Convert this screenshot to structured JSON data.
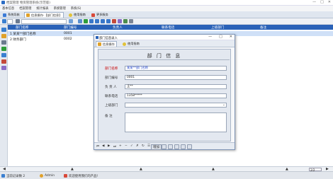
{
  "window": {
    "title": "档案管理 物资管理系统(示范版)",
    "controls": [
      "—",
      "□",
      "✕"
    ]
  },
  "menu": [
    "基本信息",
    "档案管理",
    "统计报表",
    "系统管理",
    "系统(S)"
  ],
  "module_tabs": [
    {
      "label": "系统导航",
      "icon": "home-icon"
    },
    {
      "label": "信息操作-【部门信息】",
      "icon": "form-icon",
      "active": true
    },
    {
      "label": "使用指南",
      "icon": "help-icon"
    },
    {
      "label": "更多服务",
      "icon": "more-icon"
    }
  ],
  "tree": {
    "columns": [
      "部门名称",
      "部门编号",
      "负责人",
      "联系电话",
      "上级部门",
      "备注"
    ],
    "rows": [
      {
        "name": "1  某某**部门名称",
        "code": "0001"
      },
      {
        "name": "2  财务部门",
        "code": "0002"
      }
    ]
  },
  "modal": {
    "title": "部门信息录入",
    "controls": [
      "—",
      "□",
      "✕"
    ],
    "tabs": [
      {
        "label": "信息操作",
        "icon": "form-icon"
      },
      {
        "label": "使用指南",
        "icon": "help-icon"
      }
    ],
    "heading": "部 门 信 息",
    "fields": [
      {
        "label": "部门名称",
        "value": "某某**部门名称",
        "required": true
      },
      {
        "label": "部门编号",
        "value": "0001",
        "required": false
      },
      {
        "label": "负 责 人",
        "value": "王**",
        "required": false
      },
      {
        "label": "联系电话",
        "value": "1358*****",
        "required": false
      },
      {
        "label": "上级部门",
        "value": "",
        "required": false
      },
      {
        "label": "备    注",
        "value": "",
        "required": false
      }
    ],
    "nav": {
      "first": "⏮",
      "prev": "◀",
      "next": "▶",
      "last": "⏭",
      "add": "+",
      "del": "−",
      "ok": "✓",
      "cancel": "✗",
      "refresh": "↻",
      "search": "☰",
      "apply": "增加"
    }
  },
  "pagebar": {
    "left_arrow": "◀",
    "right_arrow": "▶",
    "center_arrow": "▲",
    "page_indicator": "2/2"
  },
  "status": {
    "record_count": "当前记录数 2",
    "user": "Admin",
    "welcome": "欢迎使用我们的产品!"
  },
  "colors": {
    "header_blue": "#2a62b8",
    "selection": "#cfe0f7",
    "required_red": "#c80000"
  }
}
